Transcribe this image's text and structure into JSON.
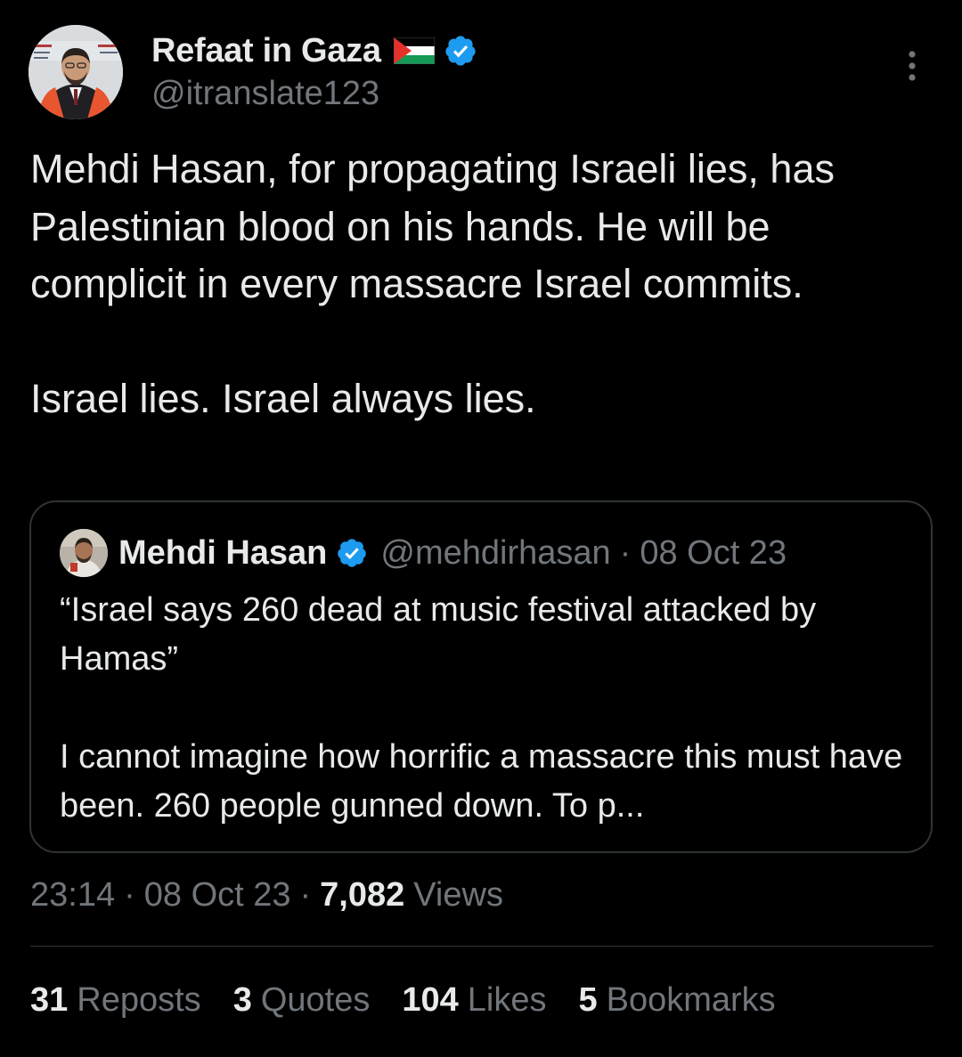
{
  "colors": {
    "background": "#000000",
    "primary_text": "#e7e9ea",
    "secondary_text": "#71767b",
    "border": "#2f3336",
    "verified_blue": "#1d9bf0"
  },
  "author": {
    "display_name": "Refaat in Gaza",
    "handle": "@itranslate123",
    "flag_icon": "palestine-flag-icon",
    "verified_icon": "verified-badge-icon",
    "menu_icon": "more-vertical-icon"
  },
  "tweet": {
    "paragraphs": [
      "Mehdi Hasan, for propagating Israeli lies, has Palestinian blood on his hands. He will be complicit in every massacre Israel commits.",
      "Israel lies. Israel always lies."
    ]
  },
  "quote": {
    "display_name": "Mehdi Hasan",
    "handle": "@mehdirhasan",
    "separator": "·",
    "date": "08 Oct 23",
    "paragraphs": [
      "“Israel says 260 dead at music festival attacked by Hamas”",
      "I cannot imagine how horrific a massacre this must have been. 260 people gunned down. To p..."
    ]
  },
  "meta": {
    "time": "23:14",
    "separator": "·",
    "date": "08 Oct 23",
    "views_count": "7,082",
    "views_label": "Views"
  },
  "stats": {
    "reposts": {
      "count": "31",
      "label": "Reposts"
    },
    "quotes": {
      "count": "3",
      "label": "Quotes"
    },
    "likes": {
      "count": "104",
      "label": "Likes"
    },
    "bookmarks": {
      "count": "5",
      "label": "Bookmarks"
    }
  }
}
